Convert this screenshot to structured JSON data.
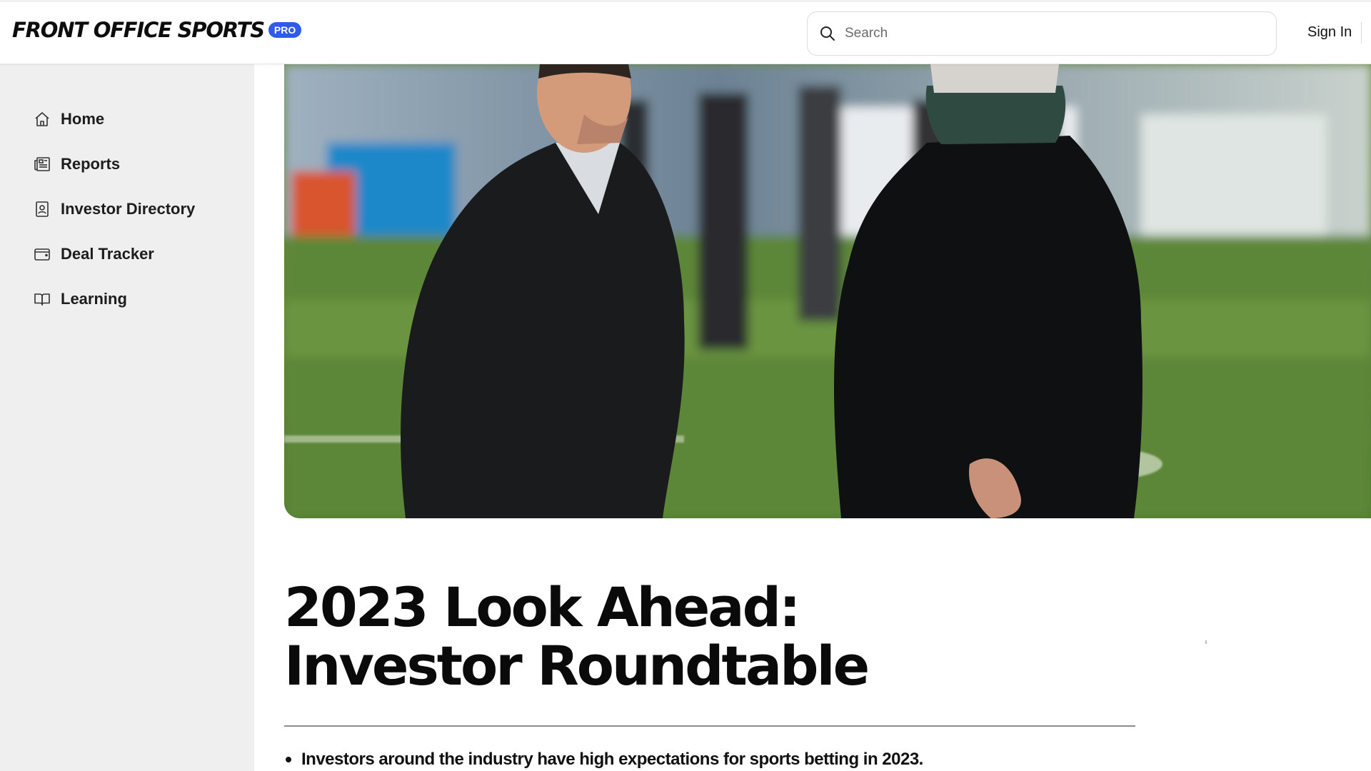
{
  "header": {
    "logo_text": "FRONT OFFICE SPORTS",
    "logo_badge": "PRO",
    "search_placeholder": "Search",
    "sign_in_label": "Sign In"
  },
  "sidebar": {
    "items": [
      {
        "label": "Home",
        "icon": "home-icon"
      },
      {
        "label": "Reports",
        "icon": "newspaper-icon"
      },
      {
        "label": "Investor Directory",
        "icon": "contact-card-icon"
      },
      {
        "label": "Deal Tracker",
        "icon": "wallet-icon"
      },
      {
        "label": "Learning",
        "icon": "book-icon"
      }
    ]
  },
  "hero": {
    "image_content": "two-men-in-dark-suits-on-football-field"
  },
  "article": {
    "title": "2023 Look Ahead: Investor Roundtable",
    "bullets": [
      "Investors around the industry have high expectations for sports betting in 2023."
    ]
  },
  "colors": {
    "brand_badge": "#2f5bea",
    "sidebar_bg": "#efefef",
    "text": "#111111"
  }
}
